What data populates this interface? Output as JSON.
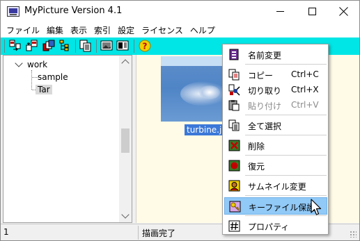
{
  "window": {
    "title": "MyPicture Version 4.1"
  },
  "menu": [
    "ファイル",
    "編集",
    "表示",
    "索引",
    "設定",
    "ライセンス",
    "ヘルプ"
  ],
  "toolbar": {
    "icons": [
      "import-icon",
      "export-icon",
      "batch-icon",
      "tree-icon",
      "copy-pages-icon",
      "image-view-icon",
      "preview-icon",
      "help-icon"
    ],
    "background": "#00e5e5"
  },
  "tree": {
    "root": "work",
    "children": [
      "sample",
      "Tar"
    ],
    "selected": "Tar"
  },
  "thumbnail": {
    "caption": "turbine.jpg"
  },
  "status": {
    "left": "1",
    "right": "描画完了"
  },
  "context_menu": {
    "items": [
      {
        "label": "名前変更",
        "shortcut": "",
        "icon": "rename-icon",
        "enabled": true,
        "highlighted": false
      },
      {
        "label": "コピー",
        "shortcut": "Ctrl+C",
        "icon": "copy-icon",
        "enabled": true,
        "highlighted": false
      },
      {
        "label": "切り取り",
        "shortcut": "Ctrl+X",
        "icon": "cut-icon",
        "enabled": true,
        "highlighted": false
      },
      {
        "label": "貼り付け",
        "shortcut": "Ctrl+V",
        "icon": "paste-icon",
        "enabled": false,
        "highlighted": false
      },
      {
        "label": "全て選択",
        "shortcut": "",
        "icon": "select-all-icon",
        "enabled": true,
        "highlighted": false
      },
      {
        "label": "削除",
        "shortcut": "",
        "icon": "delete-icon",
        "enabled": true,
        "highlighted": false
      },
      {
        "label": "復元",
        "shortcut": "",
        "icon": "restore-icon",
        "enabled": true,
        "highlighted": false
      },
      {
        "label": "サムネイル変更",
        "shortcut": "",
        "icon": "thumbnail-change-icon",
        "enabled": true,
        "highlighted": false
      },
      {
        "label": "キーファイル保護",
        "shortcut": "",
        "icon": "key-icon",
        "enabled": true,
        "highlighted": true
      },
      {
        "label": "プロパティ",
        "shortcut": "",
        "icon": "properties-icon",
        "enabled": true,
        "highlighted": false
      }
    ],
    "highlight_color": "#91c9f7"
  }
}
